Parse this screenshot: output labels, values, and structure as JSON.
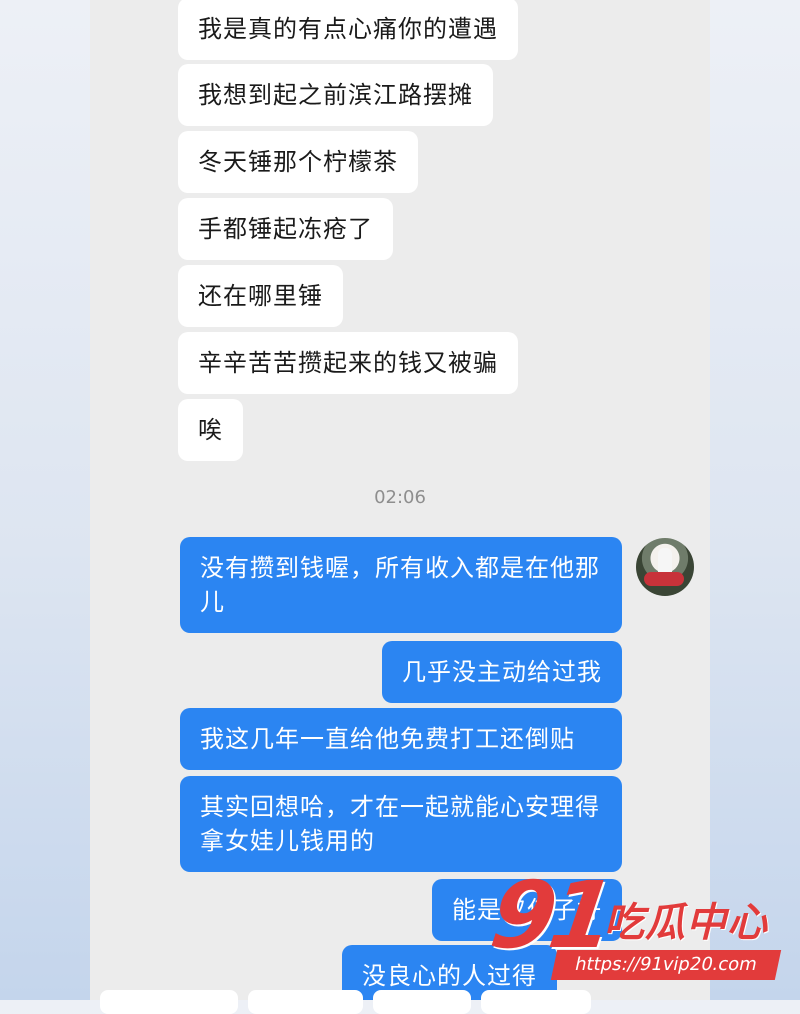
{
  "incoming_messages": [
    "我是真的有点心痛你的遭遇",
    "我想到起之前滨江路摆摊",
    "冬天锤那个柠檬茶",
    "手都锤起冻疮了",
    "还在哪里锤",
    "辛辛苦苦攒起来的钱又被骗",
    "唉"
  ],
  "timestamp": "02:06",
  "outgoing_messages": [
    "没有攒到钱喔，所有收入都是在他那儿",
    "几乎没主动给过我",
    "我这几年一直给他免费打工还倒贴",
    "其实回想哈，才在一起就能心安理得拿女娃儿钱用的",
    "能是仅仅子好",
    "没良心的人过得"
  ],
  "watermark": {
    "logo": "91",
    "name": "吃瓜中心",
    "url": "https://91vip20.com"
  },
  "colors": {
    "outgoing_bubble": "#2b85f2",
    "incoming_bubble": "#ffffff",
    "chat_background": "#ececec",
    "watermark": "#e23b3b"
  }
}
